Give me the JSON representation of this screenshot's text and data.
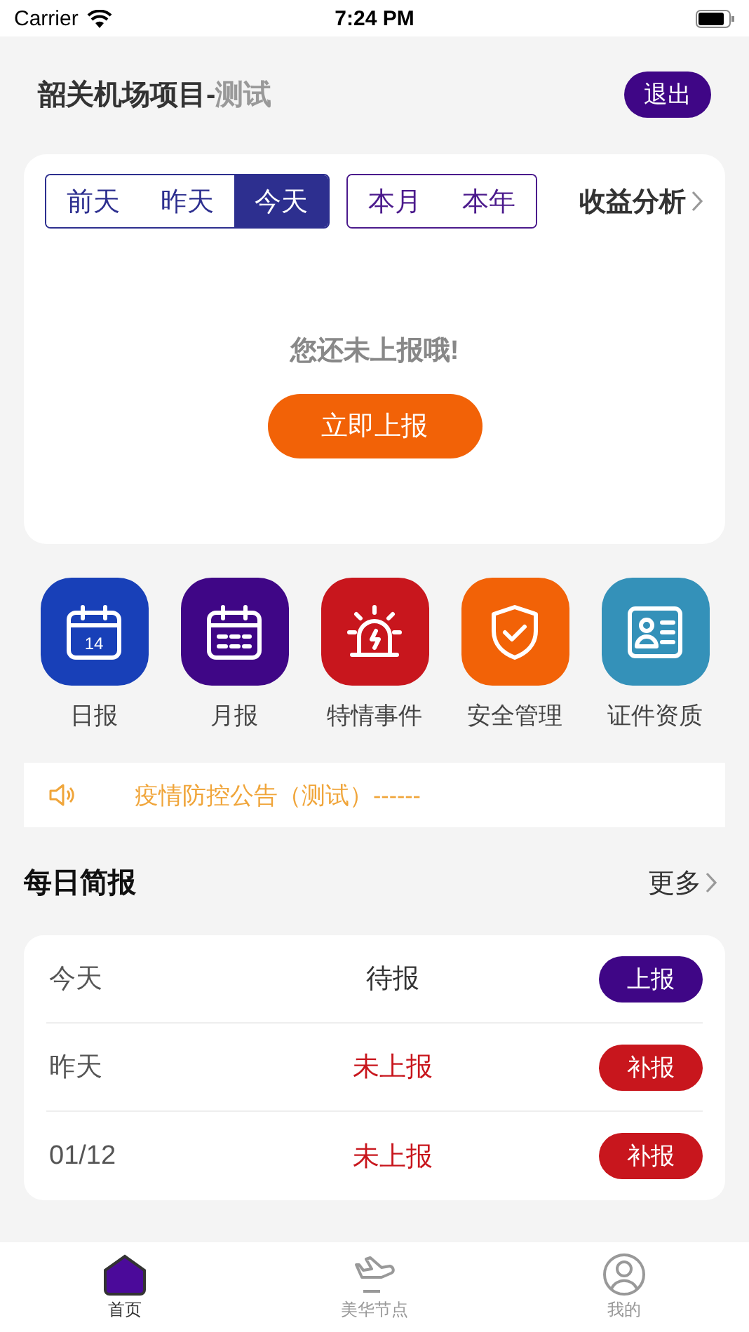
{
  "status_bar": {
    "carrier": "Carrier",
    "time": "7:24 PM"
  },
  "header": {
    "title": "韶关机场项目-",
    "title_suffix": "测试",
    "logout": "退出"
  },
  "day_tabs": [
    {
      "label": "前天",
      "selected": false
    },
    {
      "label": "昨天",
      "selected": false
    },
    {
      "label": "今天",
      "selected": true
    }
  ],
  "range_tabs": [
    {
      "label": "本月",
      "selected": false
    },
    {
      "label": "本年",
      "selected": false
    }
  ],
  "analysis_link": "收益分析",
  "empty_message": "您还未上报哦!",
  "report_now": "立即上报",
  "shortcuts": [
    {
      "label": "日报",
      "kind": "daily",
      "color": "#1840b8"
    },
    {
      "label": "月报",
      "kind": "monthly",
      "color": "#3f0686"
    },
    {
      "label": "特情事件",
      "kind": "alarm",
      "color": "#c8161d"
    },
    {
      "label": "安全管理",
      "kind": "shield",
      "color": "#f26207"
    },
    {
      "label": "证件资质",
      "kind": "idcard",
      "color": "#3491b9"
    }
  ],
  "daily_icon_day": "14",
  "notice": "疫情防控公告（测试）------",
  "brief": {
    "title": "每日简报",
    "more": "更多",
    "rows": [
      {
        "date": "今天",
        "status": "待报",
        "action": "上报",
        "kind": "pending"
      },
      {
        "date": "昨天",
        "status": "未上报",
        "action": "补报",
        "kind": "missed"
      },
      {
        "date": "01/12",
        "status": "未上报",
        "action": "补报",
        "kind": "missed"
      }
    ]
  },
  "tab_bar": [
    {
      "label": "首页",
      "kind": "home",
      "selected": true
    },
    {
      "label": "美华节点",
      "kind": "plane",
      "selected": false
    },
    {
      "label": "我的",
      "kind": "profile",
      "selected": false
    }
  ]
}
